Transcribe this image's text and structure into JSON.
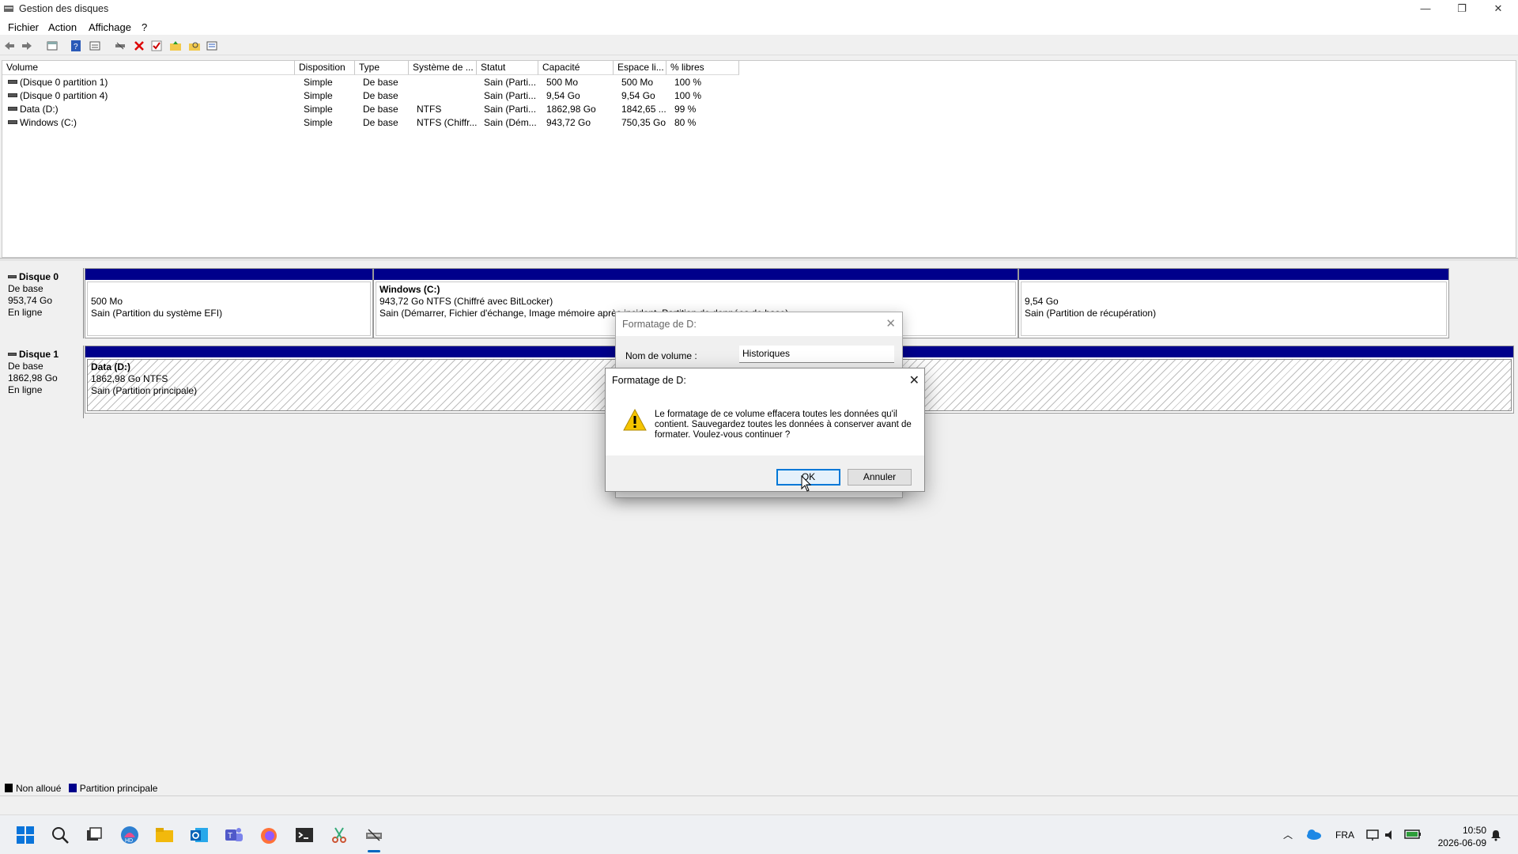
{
  "window": {
    "title": "Gestion des disques",
    "minimize": "—",
    "restore": "❐",
    "close": "✕"
  },
  "menu": [
    "Fichier",
    "Action",
    "Affichage",
    "?"
  ],
  "volume_list": {
    "columns": [
      "Volume",
      "Disposition",
      "Type",
      "Système de ...",
      "Statut",
      "Capacité",
      "Espace li...",
      "% libres"
    ],
    "rows": [
      [
        "(Disque 0 partition 1)",
        "Simple",
        "De base",
        "",
        "Sain (Parti...",
        "500 Mo",
        "500 Mo",
        "100 %"
      ],
      [
        "(Disque 0 partition 4)",
        "Simple",
        "De base",
        "",
        "Sain (Parti...",
        "9,54 Go",
        "9,54 Go",
        "100 %"
      ],
      [
        "Data (D:)",
        "Simple",
        "De base",
        "NTFS",
        "Sain (Parti...",
        "1862,98 Go",
        "1842,65 ...",
        "99 %"
      ],
      [
        "Windows (C:)",
        "Simple",
        "De base",
        "NTFS (Chiffr...",
        "Sain (Dém...",
        "943,72 Go",
        "750,35 Go",
        "80 %"
      ]
    ]
  },
  "disks": [
    {
      "name": "Disque 0",
      "type": "De base",
      "size": "953,74 Go",
      "status": "En ligne",
      "partitions": [
        {
          "title": "",
          "line1": "500 Mo",
          "line2": "Sain (Partition du système EFI)"
        },
        {
          "title": "Windows  (C:)",
          "line1": "943,72 Go NTFS (Chiffré avec BitLocker)",
          "line2": "Sain (Démarrer, Fichier d'échange, Image mémoire après incident, Partition de données de base)"
        },
        {
          "title": "",
          "line1": "9,54 Go",
          "line2": "Sain (Partition de récupération)"
        }
      ]
    },
    {
      "name": "Disque 1",
      "type": "De base",
      "size": "1862,98 Go",
      "status": "En ligne",
      "partitions": [
        {
          "title": "Data  (D:)",
          "line1": "1862,98 Go NTFS",
          "line2": "Sain (Partition principale)"
        }
      ]
    }
  ],
  "legend": [
    {
      "label": "Non alloué",
      "color": "#000000"
    },
    {
      "label": "Partition principale",
      "color": "#00008b"
    }
  ],
  "format_dialog": {
    "title": "Formatage de D:",
    "volume_name_label": "Nom de volume :",
    "volume_name_value": "Historiques"
  },
  "confirm_dialog": {
    "title": "Formatage de D:",
    "message": "Le formatage de ce volume effacera toutes les données qu'il contient. Sauvegardez toutes les données à conserver avant de formater. Voulez-vous continuer ?",
    "ok_label": "OK",
    "cancel_label": "Annuler",
    "icon": "warning-icon"
  },
  "taskbar": {
    "apps": [
      "start-icon",
      "search-icon",
      "task-view-icon",
      "copilot-icon",
      "file-explorer-icon",
      "outlook-icon",
      "teams-icon",
      "firefox-icon",
      "terminal-icon",
      "snipping-tool-icon",
      "disk-management-icon"
    ],
    "language": "FRA",
    "time": "10:50",
    "date": "2026-06-09"
  },
  "colors": {
    "partition_bar": "#00008b",
    "accent": "#0078d7",
    "warning": "#f5c400"
  }
}
